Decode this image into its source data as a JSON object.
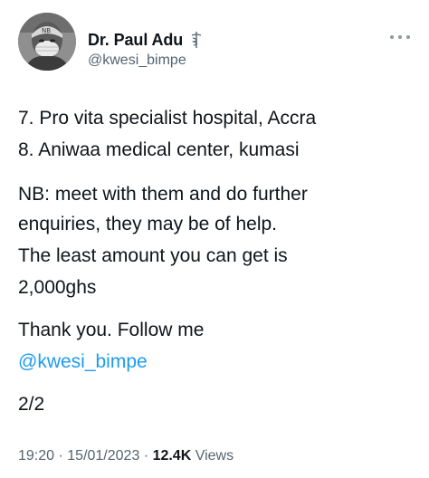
{
  "author": {
    "name": "Dr. Paul Adu",
    "handle": "@kwesi_bimpe",
    "avatar_icon": "profile-photo-masked-doctor",
    "badge_icon": "caduceus-icon"
  },
  "more_icon": "more-options-icon",
  "tweet": {
    "lines": {
      "l1": "7. Pro vita specialist hospital, Accra",
      "l2": "8. Aniwaa medical center, kumasi",
      "l3": "NB: meet with them and do further",
      "l4": "enquiries, they may be of help.",
      "l5": "The least amount you can get is",
      "l6": "2,000ghs",
      "l7": "Thank you. Follow me",
      "l8": "@kwesi_bimpe",
      "l9": "2/2"
    }
  },
  "meta": {
    "time": "19:20",
    "sep1": " · ",
    "date": "15/01/2023",
    "sep2": " · ",
    "views_count": "12.4K",
    "views_label": " Views"
  },
  "colors": {
    "text": "#0f1419",
    "secondary": "#536471",
    "link": "#1d9bf0"
  }
}
